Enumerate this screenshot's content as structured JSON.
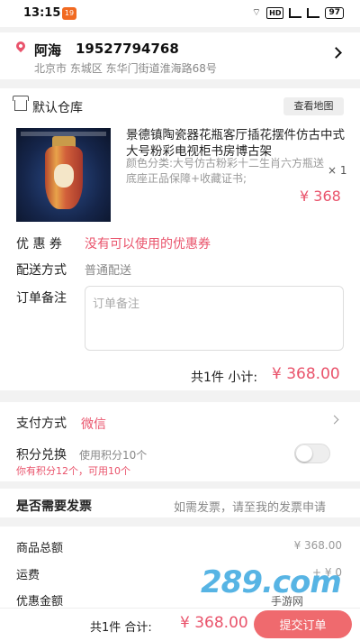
{
  "status_bar": {
    "time": "13:15",
    "app_badge": "19",
    "hd": "HD",
    "battery": "97"
  },
  "address": {
    "name": "阿海",
    "phone": "19527794768",
    "detail": "北京市 东城区 东华门街道淮海路68号"
  },
  "store": {
    "name": "默认仓库",
    "view_map_label": "查看地图"
  },
  "product": {
    "title": "景德镇陶瓷器花瓶客厅插花摆件仿古中式大号粉彩电视柜书房博古架",
    "spec": "颜色分类:大号仿古粉彩十二生肖六方瓶送底座正品保障+收藏证书;",
    "qty": "× 1",
    "price": "¥ 368"
  },
  "coupon": {
    "label": "优 惠 券",
    "value": "没有可以使用的优惠券"
  },
  "delivery": {
    "label": "配送方式",
    "value": "普通配送"
  },
  "note": {
    "label": "订单备注",
    "placeholder": "订单备注"
  },
  "subtotal": {
    "label": "共1件  小计:",
    "amount": "¥ 368.00"
  },
  "payment": {
    "label": "支付方式",
    "value": "微信"
  },
  "points": {
    "label": "积分兑换",
    "hint": "使用积分10个",
    "sub": "你有积分12个，可用10个"
  },
  "invoice": {
    "label": "是否需要发票",
    "hint": "如需发票，请至我的发票申请"
  },
  "totals": {
    "goods_label": "商品总额",
    "goods_value": "¥ 368.00",
    "shipping_label": "运费",
    "shipping_value": "+ ¥ 0",
    "discount_label": "优惠金额"
  },
  "watermark": {
    "logo": "289.com",
    "sub": "手游网"
  },
  "bottom": {
    "total_label": "共1件  合计:",
    "total_amount": "¥ 368.00",
    "submit_label": "提交订单"
  },
  "colors": {
    "accent": "#e9536b",
    "button": "#ef6a6e",
    "background": "#f2f2f2"
  }
}
